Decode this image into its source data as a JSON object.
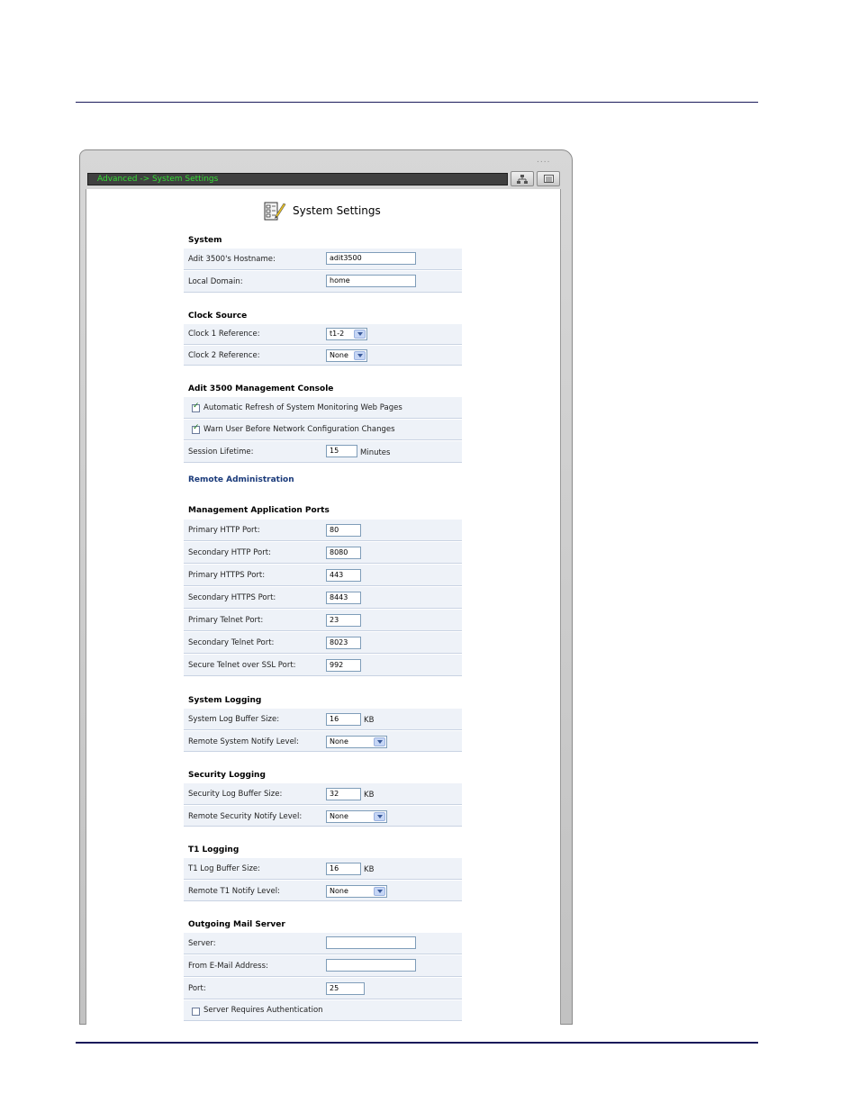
{
  "window": {
    "breadcrumb": "Advanced -> System Settings",
    "grip": "....",
    "accent_green": "#33dd33"
  },
  "page": {
    "title": "System Settings",
    "icon": "settings-checklist-icon"
  },
  "system": {
    "title": "System",
    "hostname_label": "Adit 3500's Hostname:",
    "hostname_value": "adit3500",
    "domain_label": "Local Domain:",
    "domain_value": "home"
  },
  "clock": {
    "title": "Clock Source",
    "clock1_label": "Clock 1 Reference:",
    "clock1_value": "t1-2",
    "clock2_label": "Clock 2 Reference:",
    "clock2_value": "None"
  },
  "console": {
    "title": "Adit 3500 Management Console",
    "auto_refresh_label": "Automatic Refresh of System Monitoring Web Pages",
    "warn_label": "Warn User Before Network Configuration Changes",
    "session_label": "Session Lifetime:",
    "session_value": "15",
    "session_unit": "Minutes"
  },
  "remote_admin": "Remote Administration",
  "ports": {
    "title": "Management Application Ports",
    "rows": [
      {
        "label": "Primary HTTP Port:",
        "value": "80"
      },
      {
        "label": "Secondary HTTP Port:",
        "value": "8080"
      },
      {
        "label": "Primary HTTPS Port:",
        "value": "443"
      },
      {
        "label": "Secondary HTTPS Port:",
        "value": "8443"
      },
      {
        "label": "Primary Telnet Port:",
        "value": "23"
      },
      {
        "label": "Secondary Telnet Port:",
        "value": "8023"
      },
      {
        "label": "Secure Telnet over SSL Port:",
        "value": "992"
      }
    ]
  },
  "system_logging": {
    "title": "System Logging",
    "buffer_label": "System Log Buffer Size:",
    "buffer_value": "16",
    "buffer_unit": "KB",
    "notify_label": "Remote System Notify Level:",
    "notify_value": "None"
  },
  "security_logging": {
    "title": "Security Logging",
    "buffer_label": "Security Log Buffer Size:",
    "buffer_value": "32",
    "buffer_unit": "KB",
    "notify_label": "Remote Security Notify Level:",
    "notify_value": "None"
  },
  "t1_logging": {
    "title": "T1 Logging",
    "buffer_label": "T1 Log Buffer Size:",
    "buffer_value": "16",
    "buffer_unit": "KB",
    "notify_label": "Remote T1 Notify Level:",
    "notify_value": "None"
  },
  "mail": {
    "title": "Outgoing Mail Server",
    "server_label": "Server:",
    "server_value": "",
    "from_label": "From E-Mail Address:",
    "from_value": "",
    "port_label": "Port:",
    "port_value": "25",
    "auth_label": "Server Requires Authentication"
  }
}
